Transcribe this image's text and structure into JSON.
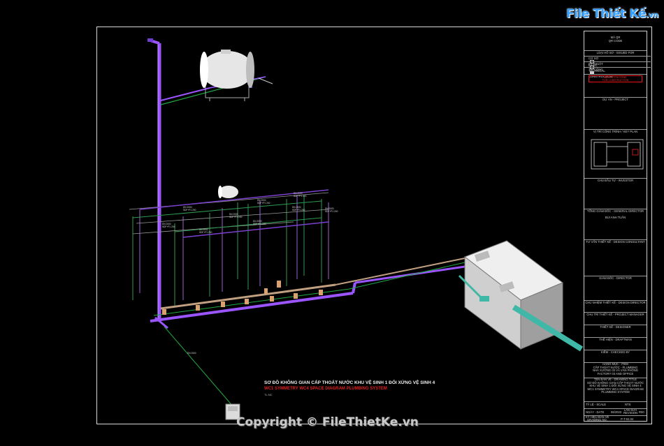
{
  "logo": {
    "main": "File Thiết Kế",
    "suffix": ".vn"
  },
  "copyright": "Copyright © FileThietKe.vn",
  "caption": {
    "vn": "SƠ ĐỒ KHÔNG GIAN CẤP THOÁT NƯỚC KHU VỆ SINH 1 ĐỐI XỨNG VỆ SINH 4",
    "en": "WC1 SYMMETRY WC4 SPACE DIAGRAM PLUMBING SYSTEM",
    "scale": "TL:NC"
  },
  "pipe_labels": [
    {
      "text": "DN 2000\nSDF+P1 200"
    },
    {
      "text": "DN 2000\nSDF+P1 200"
    },
    {
      "text": "DN 2000\nSDF+P1 200"
    },
    {
      "text": "DN 2000\nSDF+P1 200"
    },
    {
      "text": "DN 2000\nSDF+P1 200"
    },
    {
      "text": "DN 2000\nSDF+P1 200"
    },
    {
      "text": "DN 2000\nSDF+P1 200"
    },
    {
      "text": "DN 2000\nSDF+P1 200"
    },
    {
      "text": "DN 2000\nSDF+P1 200"
    }
  ],
  "title_block": {
    "qr": "MÃ QR\nQR CODE",
    "issue_header": "LOẠI HỒ SƠ - ISSUED FOR",
    "issue_rows": [
      {
        "vn": "CƠ SỞ",
        "en": "BASIC"
      },
      {
        "vn": "KỸ THUẬT",
        "en": "TECHNICAL"
      },
      {
        "vn": "THI CÔNG",
        "en": "CONSTRUCTION"
      }
    ],
    "stamp": "BẢN VẼ THI CÔNG\nFOR CONSTRUCTION",
    "project": "DỰ ÁN - PROJECT",
    "key_plan": "VỊ TRÍ CÔNG TRÌNH / KEY PLAN",
    "investor": "CHỦ ĐẦU TƯ - INVESTOR",
    "general_director": "TỔNG GIÁM ĐỐC - GENERAL DIRECTOR",
    "director_name": "BÙI ANH TUẤN",
    "design_consultant": "TƯ VẤN THIẾT KẾ - DESIGN CONSULTANT",
    "director": "GIÁM ĐỐC - DIRECTOR",
    "design_director": "CHỦ NHIỆM THIẾT KẾ - DESIGN DIRECTOR",
    "project_manager": "CHỦ TRÌ THIẾT KẾ - PROJECT MANAGER",
    "designer": "THIẾT KẾ - DESIGNER",
    "draftman": "THỂ HIỆN - DRAFTMAN",
    "checked": "KIỂM - CHECKED BY",
    "item": "HẠNG MỤC - ITEM\nCẤP THOÁT NƯỚC - PLUMBING\nNHÀ XƯỞNG 03 VÀ VĂN PHÒNG\nFACTORY 03 AND OFFICE",
    "drawing_title": "TÊN BẢN VẼ - DRAWING TITLE\nSƠ ĐỒ KHÔNG GIAN CẤP THOÁT NƯỚC\nKHU VỆ SINH 1 ĐỐI XỨNG VỆ SINH 4\nWC1 SYMMETRY WC4 SPACE DIAGRAM\nPLUMBING SYSTEM",
    "scale_label": "TỶ LỆ - SCALE",
    "scale_value": "NTS",
    "date_label": "NGÀY - DATE",
    "date_value": "06/2023",
    "revision_label": "LẦN SỬA\nREVISION",
    "revision_value": "R00",
    "drawing_no_label": "KÝ HIỆU BẢN VẼ\nDRAWING NO.",
    "drawing_no_value": "P-T-04.04"
  }
}
